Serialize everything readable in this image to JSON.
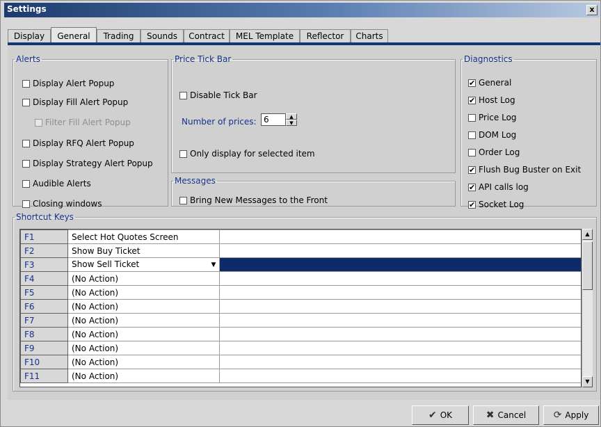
{
  "window": {
    "title": "Settings",
    "close_glyph": "x"
  },
  "tabs": [
    "Display",
    "General",
    "Trading",
    "Sounds",
    "Contract",
    "MEL Template",
    "Reflector",
    "Charts"
  ],
  "active_tab": "General",
  "alerts": {
    "legend": "Alerts",
    "items": [
      {
        "label": "Display Alert Popup",
        "checked": false,
        "enabled": true
      },
      {
        "label": "Display Fill Alert Popup",
        "checked": false,
        "enabled": true
      },
      {
        "label": "Filter Fill Alert Popup",
        "checked": false,
        "enabled": false
      },
      {
        "label": "Display RFQ Alert Popup",
        "checked": false,
        "enabled": true
      },
      {
        "label": "Display Strategy Alert Popup",
        "checked": false,
        "enabled": true
      },
      {
        "label": "Audible Alerts",
        "checked": false,
        "enabled": true
      },
      {
        "label": "Closing windows",
        "checked": false,
        "enabled": true
      }
    ]
  },
  "price_tick_bar": {
    "legend": "Price Tick Bar",
    "disable_label": "Disable Tick Bar",
    "disable_checked": false,
    "num_prices_label": "Number of prices:",
    "num_prices_value": "6",
    "only_selected_label": "Only display for selected item",
    "only_selected_checked": false
  },
  "messages": {
    "legend": "Messages",
    "bring_front_label": "Bring New Messages to the Front",
    "bring_front_checked": false
  },
  "diagnostics": {
    "legend": "Diagnostics",
    "items": [
      {
        "label": "General",
        "checked": true
      },
      {
        "label": "Host Log",
        "checked": true
      },
      {
        "label": "Price Log",
        "checked": false
      },
      {
        "label": "DOM Log",
        "checked": false
      },
      {
        "label": "Order Log",
        "checked": false
      },
      {
        "label": "Flush Bug Buster on Exit",
        "checked": true
      },
      {
        "label": "API calls log",
        "checked": true
      },
      {
        "label": "Socket Log",
        "checked": true
      }
    ]
  },
  "shortcut_keys": {
    "legend": "Shortcut Keys",
    "rows": [
      {
        "key": "F1",
        "action": "Select Hot Quotes Screen"
      },
      {
        "key": "F2",
        "action": "Show Buy Ticket"
      },
      {
        "key": "F3",
        "action": "Show Sell Ticket"
      },
      {
        "key": "F4",
        "action": "(No Action)"
      },
      {
        "key": "F5",
        "action": "(No Action)"
      },
      {
        "key": "F6",
        "action": "(No Action)"
      },
      {
        "key": "F7",
        "action": "(No Action)"
      },
      {
        "key": "F8",
        "action": "(No Action)"
      },
      {
        "key": "F9",
        "action": "(No Action)"
      },
      {
        "key": "F10",
        "action": "(No Action)"
      },
      {
        "key": "F11",
        "action": "(No Action)"
      }
    ],
    "selected_key": "F3"
  },
  "buttons": {
    "ok": "OK",
    "cancel": "Cancel",
    "apply": "Apply"
  }
}
